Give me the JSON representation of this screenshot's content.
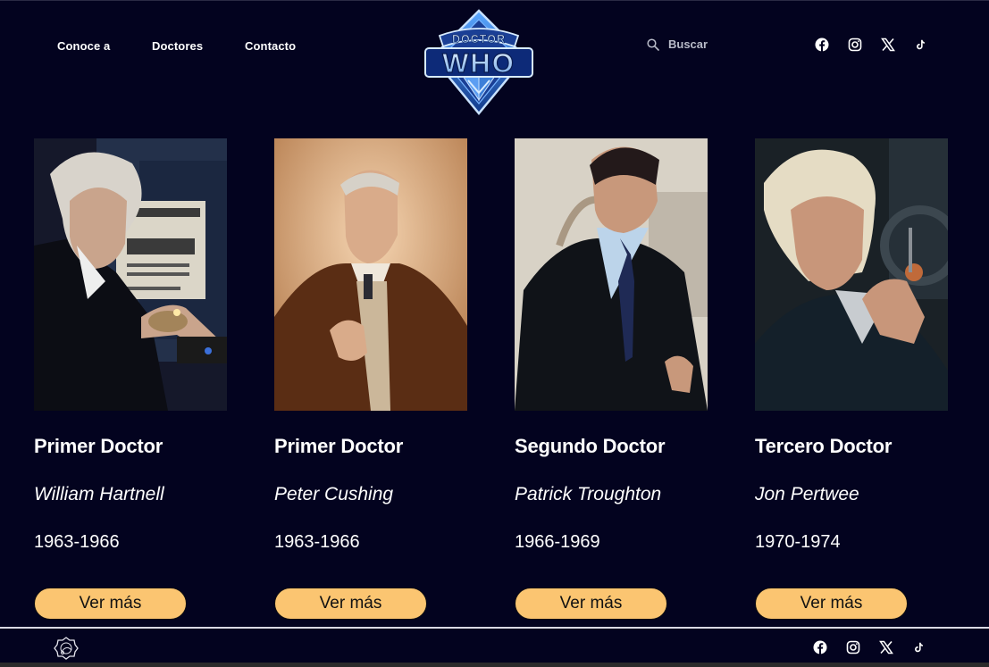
{
  "header": {
    "nav": [
      {
        "label": "Conoce a"
      },
      {
        "label": "Doctores"
      },
      {
        "label": "Contacto"
      }
    ],
    "logo": {
      "line1": "DOCTOR",
      "line2": "WHO"
    },
    "search": {
      "label": "Buscar",
      "icon": "search-icon"
    },
    "social": [
      "facebook-icon",
      "instagram-icon",
      "x-icon",
      "tiktok-icon"
    ]
  },
  "doctors": [
    {
      "title": "Primer Doctor",
      "actor": "William Hartnell",
      "years": "1963-1966",
      "button": "Ver más"
    },
    {
      "title": "Primer Doctor",
      "actor": "Peter Cushing",
      "years": "1963-1966",
      "button": "Ver más"
    },
    {
      "title": "Segundo Doctor",
      "actor": "Patrick Troughton",
      "years": "1966-1969",
      "button": "Ver más"
    },
    {
      "title": "Tercero Doctor",
      "actor": "Jon Pertwee",
      "years": "1970-1974",
      "button": "Ver más"
    }
  ],
  "footer": {
    "logo": "tardis-seal-icon",
    "social": [
      "facebook-icon",
      "instagram-icon",
      "x-icon",
      "tiktok-icon"
    ]
  },
  "colors": {
    "background": "#03031f",
    "button": "#fbc571",
    "logo_blue": "#1f3f9e",
    "logo_light": "#8fc2ff"
  }
}
